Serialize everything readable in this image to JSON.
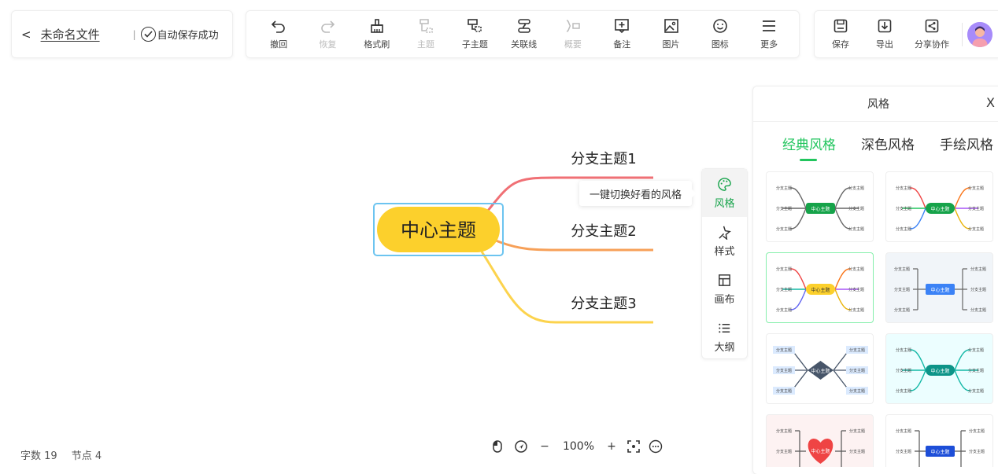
{
  "file": {
    "back_glyph": "<",
    "name": "未命名文件",
    "separator": "|",
    "autosave": "自动保存成功"
  },
  "toolbar": [
    {
      "id": "undo",
      "label": "撤回",
      "icon": "undo-icon",
      "disabled": false
    },
    {
      "id": "redo",
      "label": "恢复",
      "icon": "redo-icon",
      "disabled": true
    },
    {
      "id": "format",
      "label": "格式刷",
      "icon": "format-brush-icon",
      "disabled": false
    },
    {
      "id": "topic",
      "label": "主题",
      "icon": "topic-icon",
      "disabled": true
    },
    {
      "id": "subtopic",
      "label": "子主题",
      "icon": "subtopic-icon",
      "disabled": false
    },
    {
      "id": "relation",
      "label": "关联线",
      "icon": "relation-line-icon",
      "disabled": false
    },
    {
      "id": "summary",
      "label": "概要",
      "icon": "summary-icon",
      "disabled": true
    },
    {
      "id": "note",
      "label": "备注",
      "icon": "note-icon",
      "disabled": false
    },
    {
      "id": "image",
      "label": "图片",
      "icon": "image-icon",
      "disabled": false
    },
    {
      "id": "emoji",
      "label": "图标",
      "icon": "emoji-icon",
      "disabled": false
    },
    {
      "id": "more",
      "label": "更多",
      "icon": "more-icon",
      "disabled": false
    }
  ],
  "actions": {
    "save": "保存",
    "export": "导出",
    "share": "分享协作"
  },
  "mindmap": {
    "center": "中心主题",
    "branches": [
      "分支主题1",
      "分支主题2",
      "分支主题3"
    ],
    "colors": {
      "center_fill": "#fcd02c",
      "branch1": "#f07075",
      "branch2": "#f7a058",
      "branch3": "#fcd34d",
      "selection": "#6cc4f0"
    }
  },
  "tooltip": "一键切换好看的风格",
  "side_tabs": [
    {
      "label": "风格",
      "icon": "palette-icon",
      "active": true
    },
    {
      "label": "样式",
      "icon": "style-icon",
      "active": false
    },
    {
      "label": "画布",
      "icon": "canvas-icon",
      "active": false
    },
    {
      "label": "大纲",
      "icon": "outline-icon",
      "active": false
    }
  ],
  "style_panel": {
    "title": "风格",
    "close": "X",
    "tabs": [
      "经典风格",
      "深色风格",
      "手绘风格"
    ],
    "active_tab": 0,
    "thumb_label": "分支主题",
    "thumb_center": "中心主题"
  },
  "stats": {
    "words": "字数 19",
    "nodes": "节点 4"
  },
  "zoom": {
    "minus": "−",
    "value": "100%",
    "plus": "+"
  },
  "accent": "#22c55e"
}
